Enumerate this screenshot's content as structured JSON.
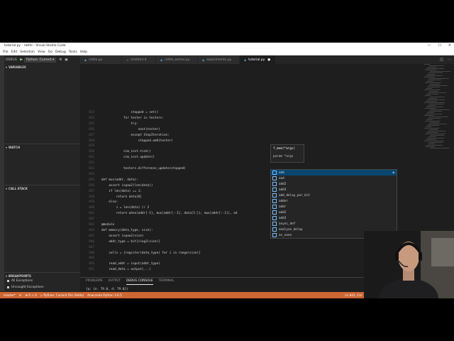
{
  "window": {
    "title": "tutorial.py - rattle - Visual Studio Code",
    "controls": [
      "—",
      "☐",
      "✕"
    ]
  },
  "menu": [
    "File",
    "Edit",
    "Selection",
    "View",
    "Go",
    "Debug",
    "Tasks",
    "Help"
  ],
  "debug": {
    "label": "DEBUG",
    "config": "Python: Current ▾"
  },
  "sections": {
    "variables": "VARIABLES",
    "watch": "WATCH",
    "call_stack": "CALL STACK",
    "breakpoints": "BREAKPOINTS"
  },
  "breakpoints": [
    "All Exceptions",
    "Uncaught Exceptions"
  ],
  "tabs": [
    "rattle.py",
    "Untitled-4",
    "rattle_extras.py",
    "experiments.py",
    "tutorial.py"
  ],
  "editor": {
    "lines": [
      {
        "n": "823",
        "code": "                stopped = set()"
      },
      {
        "n": "824",
        "code": "            for tester in testers:"
      },
      {
        "n": "825",
        "code": "                try:"
      },
      {
        "n": "826",
        "code": "                    next(tester)"
      },
      {
        "n": "827",
        "code": "                except StopIteration:"
      },
      {
        "n": "828",
        "code": "                    stopped.add(tester)"
      },
      {
        "n": "829",
        "code": ""
      },
      {
        "n": "830",
        "code": "            sim_inst.tick()"
      },
      {
        "n": "831",
        "code": "            sim_inst.update()"
      },
      {
        "n": "832",
        "code": ""
      },
      {
        "n": "833",
        "code": "            testers.difference_update(stopped)"
      },
      {
        "n": "834",
        "code": ""
      },
      {
        "n": "835",
        "code": "def mux(addr, data):"
      },
      {
        "n": "836",
        "code": "    assert ispow2(len(data))"
      },
      {
        "n": "837",
        "code": "    if len(data) == 1:"
      },
      {
        "n": "838",
        "code": "        return data[0]"
      },
      {
        "n": "839",
        "code": "    else:"
      },
      {
        "n": "840",
        "code": "        i = len(data) // 2"
      },
      {
        "n": "841",
        "code": "        return when(addr[-1], mux(addr[:-1], data[1:]), mux(addr[:-1]), ad"
      },
      {
        "n": "842",
        "code": ""
      },
      {
        "n": "843",
        "code": "@module"
      },
      {
        "n": "844",
        "code": "def memory(data_type, size):"
      },
      {
        "n": "845",
        "code": "    assert ispow2(size)"
      },
      {
        "n": "846",
        "code": "    addr_type = bit[clog2(size)]"
      },
      {
        "n": "847",
        "code": ""
      },
      {
        "n": "848",
        "code": "    cells = [register(data_type) for i in range(size)]"
      },
      {
        "n": "849",
        "code": ""
      },
      {
        "n": "850",
        "code": "    read_addr = input(addr_type)"
      },
      {
        "n": "851",
        "code": "    read_data = output(...)"
      }
    ]
  },
  "param_hint": {
    "signature": "f_mem(*args)",
    "param": "param *args"
  },
  "suggestions": [
    "add",
    "and",
    "add2",
    "add3",
    "add_delay_per_bit",
    "adder",
    "addr",
    "add2",
    "add3",
    "async_def",
    "analyze_delay",
    "as_none"
  ],
  "panel": {
    "tabs": [
      "PROBLEMS",
      "OUTPUT",
      "DEBUG CONSOLE",
      "TERMINAL"
    ],
    "active_tab": "DEBUG CONSOLE",
    "lines": [
      "{q: {n: 79.0, d: 79.0}}",
      "{q: {n: 75.39850002884624, d: 75.39850002884624}}"
    ],
    "prompt": ">"
  },
  "status": {
    "branch": "master*",
    "sync": "⟳",
    "errors": "⊗ 0 ⚠ 0",
    "debug_config": "▷ Python: Current File (Hello)",
    "interpreter": "Anaconda Python 3.6.5",
    "position": "Ln 841, Col"
  },
  "colors": {
    "status_bar": "#cc6633",
    "editor_bg": "#1e1e1e",
    "sidebar_bg": "#252526"
  }
}
